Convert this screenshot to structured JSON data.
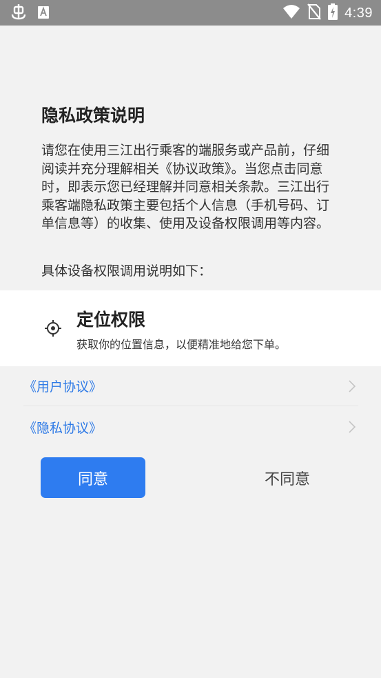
{
  "status_bar": {
    "time": "4:39",
    "icons": [
      "bug-icon",
      "a-box-icon",
      "wifi-icon",
      "no-sim-icon",
      "battery-charging-icon"
    ]
  },
  "dialog": {
    "title": "隐私政策说明",
    "description": "请您在使用三江出行乘客的端服务或产品前，仔细阅读并充分理解相关《协议政策》。当您点击同意时，即表示您已经理解并同意相关条款。三江出行乘客端隐私政策主要包括个人信息（手机号码、订单信息等）的收集、使用及设备权限调用等内容。",
    "permissions_intro": "具体设备权限调用说明如下：",
    "permission": {
      "icon": "location-target-icon",
      "name": "定位权限",
      "description": "获取你的位置信息，以便精准地给您下单。"
    },
    "links": [
      {
        "label": "《用户协议》"
      },
      {
        "label": "《隐私协议》"
      }
    ],
    "agree_label": "同意",
    "disagree_label": "不同意"
  },
  "colors": {
    "accent": "#2e7cf0",
    "link": "#2e7ae6",
    "status_bar": "#8c8c8c",
    "background": "#f2f2f2"
  }
}
